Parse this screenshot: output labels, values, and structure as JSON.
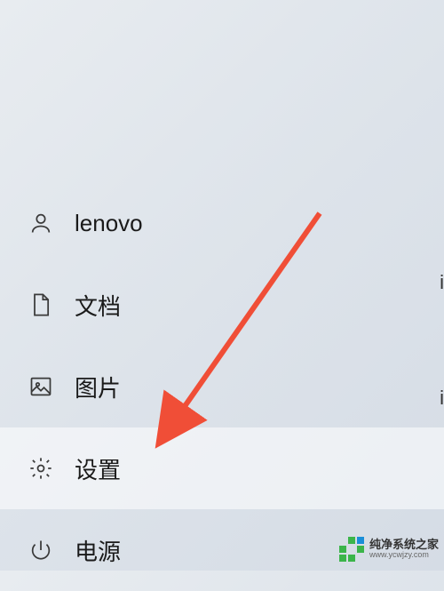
{
  "menu": {
    "user": {
      "label": "lenovo"
    },
    "documents": {
      "label": "文档"
    },
    "pictures": {
      "label": "图片"
    },
    "settings": {
      "label": "设置"
    },
    "power": {
      "label": "电源"
    }
  },
  "watermark": {
    "title": "纯净系统之家",
    "url": "www.ycwjzy.com"
  },
  "edge": {
    "e1": "",
    "e2": "",
    "e3": "i",
    "e4": "i"
  }
}
